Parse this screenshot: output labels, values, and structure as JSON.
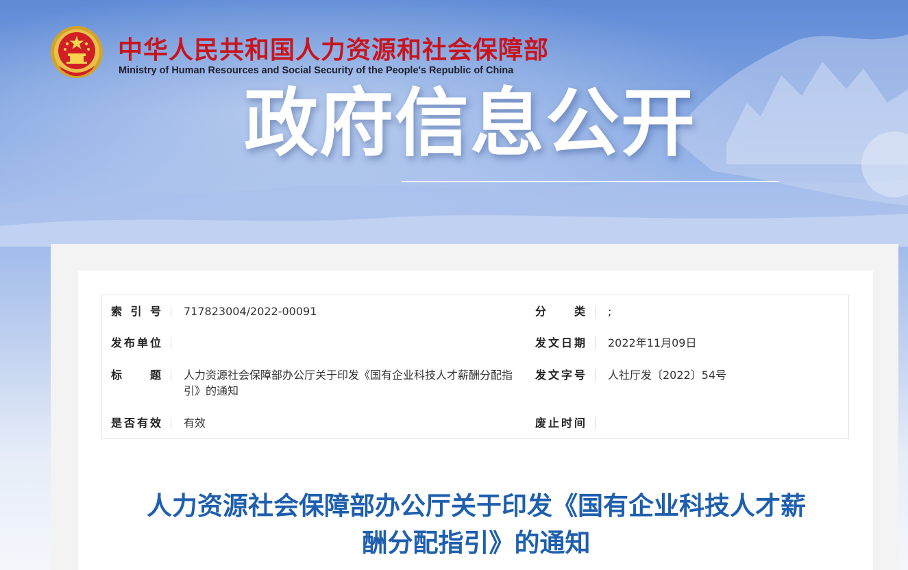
{
  "header": {
    "ministry_cn": "中华人民共和国人力资源和社会保障部",
    "ministry_en": "Ministry of Human Resources and Social Security of the People's Republic of China",
    "banner_title": "政府信息公开"
  },
  "meta": {
    "index_no": {
      "label": "索引号",
      "value": "717823004/2022-00091"
    },
    "category": {
      "label": "分类",
      "value": ";"
    },
    "publisher": {
      "label": "发布单位",
      "value": ""
    },
    "issue_date": {
      "label": "发文日期",
      "value": "2022年11月09日"
    },
    "title": {
      "label": "标题",
      "value": "人力资源社会保障部办公厅关于印发《国有企业科技人才薪酬分配指引》的通知"
    },
    "doc_number": {
      "label": "发文字号",
      "value": "人社厅发〔2022〕54号"
    },
    "validity": {
      "label": "是否有效",
      "value": "有效"
    },
    "expiry": {
      "label": "废止时间",
      "value": ""
    }
  },
  "document": {
    "title_line1": "人力资源社会保障部办公厅关于印发《国有企业科技人才薪",
    "title_line2": "酬分配指引》的通知"
  },
  "colors": {
    "ministry_red": "#c8151d",
    "title_blue": "#1e5fae",
    "banner_sky": "#7ea2e2"
  },
  "icons": {
    "emblem": "national-emblem-icon"
  }
}
